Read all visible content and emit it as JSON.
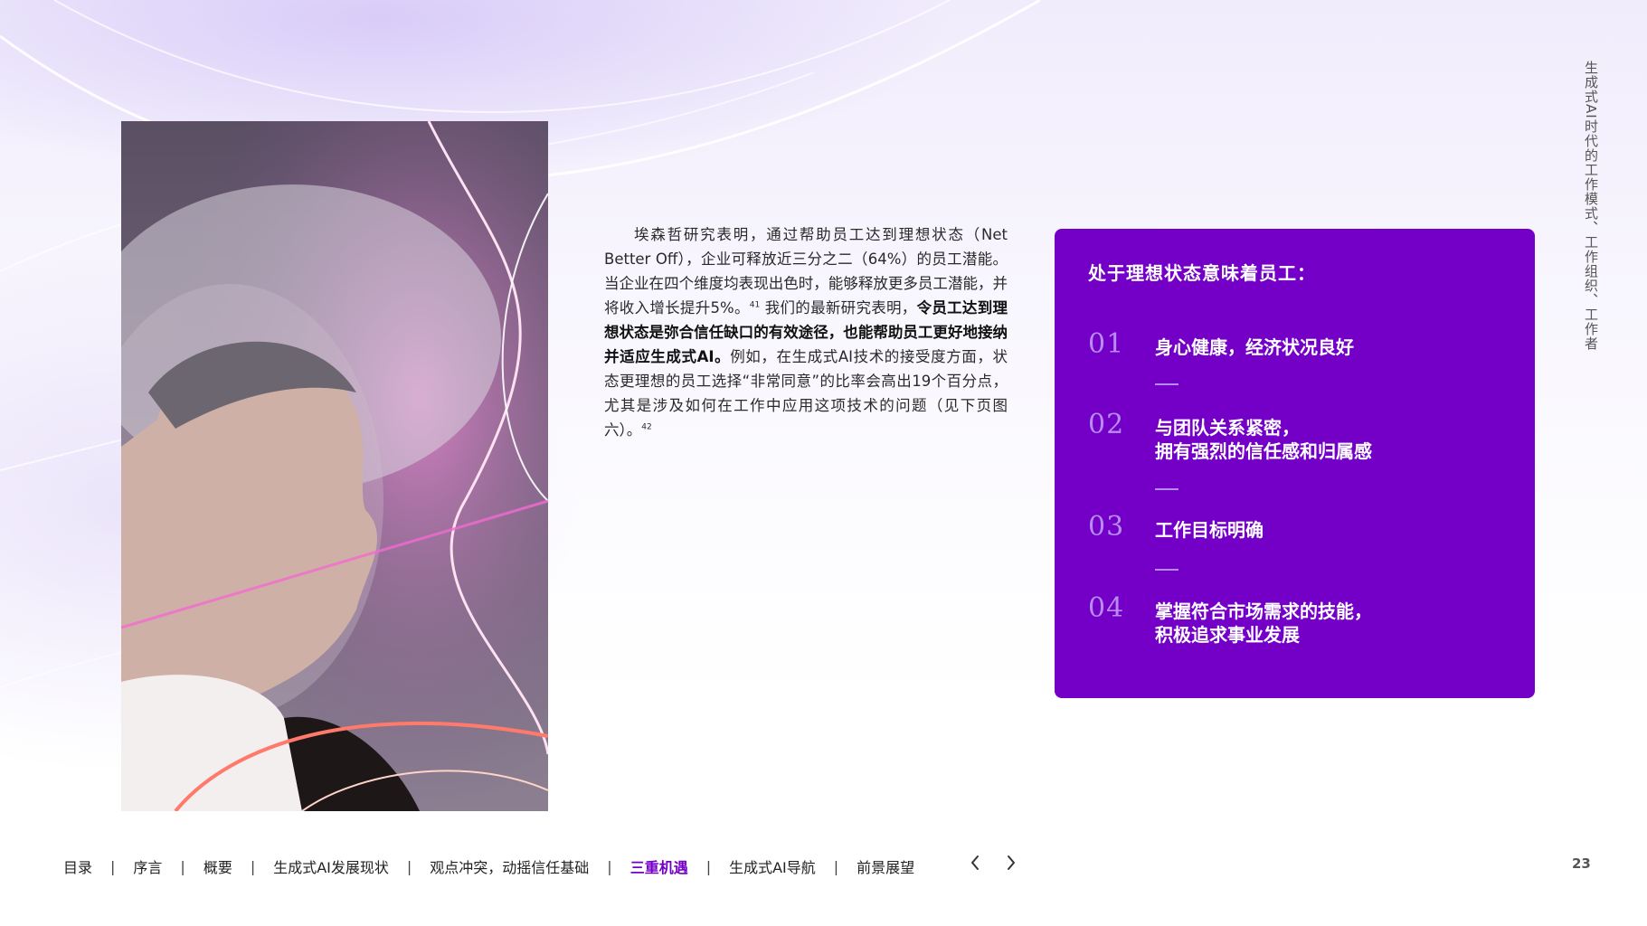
{
  "side_title": "生成式AI时代的工作模式、工作组织、工作者",
  "body": {
    "p1_normal_a": "埃森哲研究表明，通过帮助员工达到理想状态（Net Better Off），企业可释放近三分之二（64%）的员工潜能。当企业在四个维度均表现出色时，能够释放更多员工潜能，并将收入增长提升5%。",
    "sup1": "41",
    "p1_normal_b": " 我们的最新研究表明，",
    "p1_bold": "令员工达到理想状态是弥合信任缺口的有效途径，也能帮助员工更好地接纳并适应生成式AI。",
    "p1_normal_c": "例如，在生成式AI技术的接受度方面，状态更理想的员工选择“非常同意”的比率会高出19个百分点，尤其是涉及如何在工作中应用这项技术的问题（见下页图六）。",
    "sup2": "42"
  },
  "panel": {
    "title": "处于理想状态意味着员工：",
    "items": [
      {
        "num": "01",
        "line1": "身心健康，经济状况良好",
        "line2": ""
      },
      {
        "num": "02",
        "line1": "与团队关系紧密，",
        "line2": "拥有强烈的信任感和归属感"
      },
      {
        "num": "03",
        "line1": "工作目标明确",
        "line2": ""
      },
      {
        "num": "04",
        "line1": "掌握符合市场需求的技能，",
        "line2": "积极追求事业发展"
      }
    ]
  },
  "nav": {
    "items": [
      "目录",
      "序言",
      "概要",
      "生成式AI发展现状",
      "观点冲突，动摇信任基础",
      "三重机遇",
      "生成式AI导航",
      "前景展望"
    ],
    "separator": "|",
    "active_index": 5
  },
  "page_number": "23",
  "colors": {
    "accent": "#7400c8",
    "number": "#b78cf2"
  },
  "icons": {
    "prev": "chevron-left-icon",
    "next": "chevron-right-icon"
  }
}
